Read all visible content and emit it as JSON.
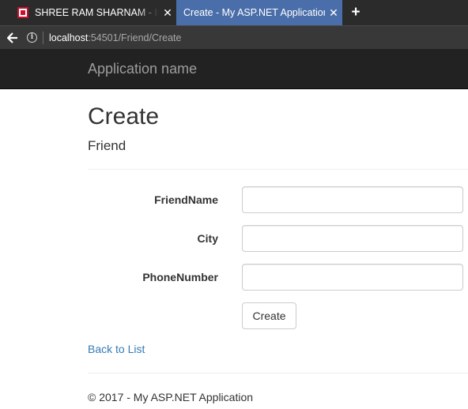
{
  "browser": {
    "tabs": [
      {
        "title": "SHREE RAM SHARNAM - Inte",
        "close": "✕",
        "active": false
      },
      {
        "title": "Create - My ASP.NET Application",
        "close": "✕",
        "active": true
      }
    ],
    "new_tab": "+",
    "back": "🡐",
    "info": "i",
    "url_host": "localhost",
    "url_path": ":54501/Friend/Create"
  },
  "navbar": {
    "brand": "Application name"
  },
  "page": {
    "title": "Create",
    "subtitle": "Friend",
    "fields": {
      "friend_name": {
        "label": "FriendName",
        "value": ""
      },
      "city": {
        "label": "City",
        "value": ""
      },
      "phone_number": {
        "label": "PhoneNumber",
        "value": ""
      }
    },
    "submit_label": "Create",
    "back_link": "Back to List"
  },
  "footer": {
    "text": "© 2017 - My ASP.NET Application"
  },
  "colors": {
    "navbar_bg": "#222222",
    "brand": "#9d9d9d",
    "link": "#337ab7",
    "active_tab": "#4a6ea9"
  }
}
